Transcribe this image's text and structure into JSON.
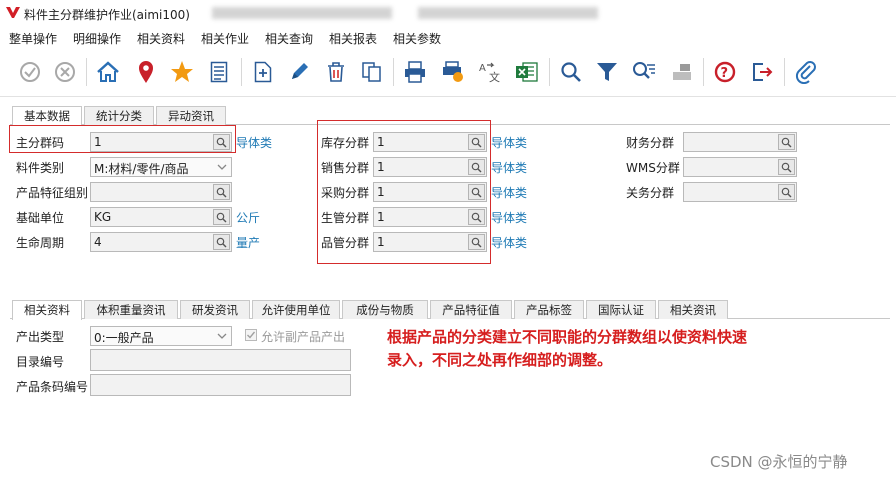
{
  "window": {
    "title": "料件主分群维护作业(aimi100)"
  },
  "menu": {
    "items": [
      "整单操作",
      "明细操作",
      "相关资料",
      "相关作业",
      "相关查询",
      "相关报表",
      "相关参数"
    ]
  },
  "toolbar": {
    "buttons": [
      {
        "name": "confirm-button",
        "icon": "check-circle-icon"
      },
      {
        "name": "cancel-button",
        "icon": "x-circle-icon"
      },
      {
        "name": "home-button",
        "icon": "home-icon"
      },
      {
        "name": "location-button",
        "icon": "map-pin-icon"
      },
      {
        "name": "favorite-button",
        "icon": "star-icon"
      },
      {
        "name": "list-button",
        "icon": "list-icon"
      },
      {
        "name": "add-button",
        "icon": "new-document-icon"
      },
      {
        "name": "edit-button",
        "icon": "pencil-icon"
      },
      {
        "name": "delete-button",
        "icon": "trash-icon"
      },
      {
        "name": "copy-button",
        "icon": "copy-icon"
      },
      {
        "name": "print-button",
        "icon": "printer-icon"
      },
      {
        "name": "print-setup-button",
        "icon": "printer-setup-icon"
      },
      {
        "name": "translate-button",
        "icon": "translate-icon"
      },
      {
        "name": "excel-export-button",
        "icon": "excel-icon"
      },
      {
        "name": "search-button",
        "icon": "magnifier-icon"
      },
      {
        "name": "filter-button",
        "icon": "filter-icon"
      },
      {
        "name": "advanced-search-button",
        "icon": "search-list-icon"
      },
      {
        "name": "sign-button",
        "icon": "stamp-icon"
      },
      {
        "name": "help-button",
        "icon": "question-icon"
      },
      {
        "name": "exit-button",
        "icon": "exit-icon"
      },
      {
        "name": "attachment-button",
        "icon": "paperclip-icon"
      }
    ]
  },
  "top_tabs": [
    "基本数据",
    "统计分类",
    "异动资讯"
  ],
  "form": {
    "col1": [
      {
        "label": "主分群码",
        "value": "1",
        "type": "lookup",
        "link": "导体类"
      },
      {
        "label": "料件类别",
        "value": "M:材料/零件/商品",
        "type": "dropdown",
        "link": ""
      },
      {
        "label": "产品特征组别",
        "value": "",
        "type": "lookup",
        "link": ""
      },
      {
        "label": "基础单位",
        "value": "KG",
        "type": "lookup",
        "link": "公斤"
      },
      {
        "label": "生命周期",
        "value": "4",
        "type": "lookup",
        "link": "量产"
      }
    ],
    "col2": [
      {
        "label": "库存分群",
        "value": "1",
        "link": "导体类"
      },
      {
        "label": "销售分群",
        "value": "1",
        "link": "导体类"
      },
      {
        "label": "采购分群",
        "value": "1",
        "link": "导体类"
      },
      {
        "label": "生管分群",
        "value": "1",
        "link": "导体类"
      },
      {
        "label": "品管分群",
        "value": "1",
        "link": "导体类"
      }
    ],
    "col3": [
      {
        "label": "财务分群",
        "value": ""
      },
      {
        "label": "WMS分群",
        "value": ""
      },
      {
        "label": "关务分群",
        "value": ""
      }
    ]
  },
  "bottom_tabs": [
    "相关资料",
    "体积重量资讯",
    "研发资讯",
    "允许使用单位",
    "成份与物质",
    "产品特征值",
    "产品标签",
    "国际认证",
    "相关资讯"
  ],
  "detail": {
    "output_type_label": "产出类型",
    "output_type_value": "0:一般产品",
    "allow_byproduct_label": "允许副产品产出",
    "catalog_no_label": "目录编号",
    "barcode_no_label": "产品条码编号"
  },
  "annotation": "根据产品的分类建立不同职能的分群数组以使资料快速录入，不同之处再作细部的调整。",
  "watermark": "CSDN @永恒的宁静",
  "colors": {
    "link": "#1f7ab5",
    "highlight": "#d42c2c",
    "annotation": "#d61e1e"
  }
}
